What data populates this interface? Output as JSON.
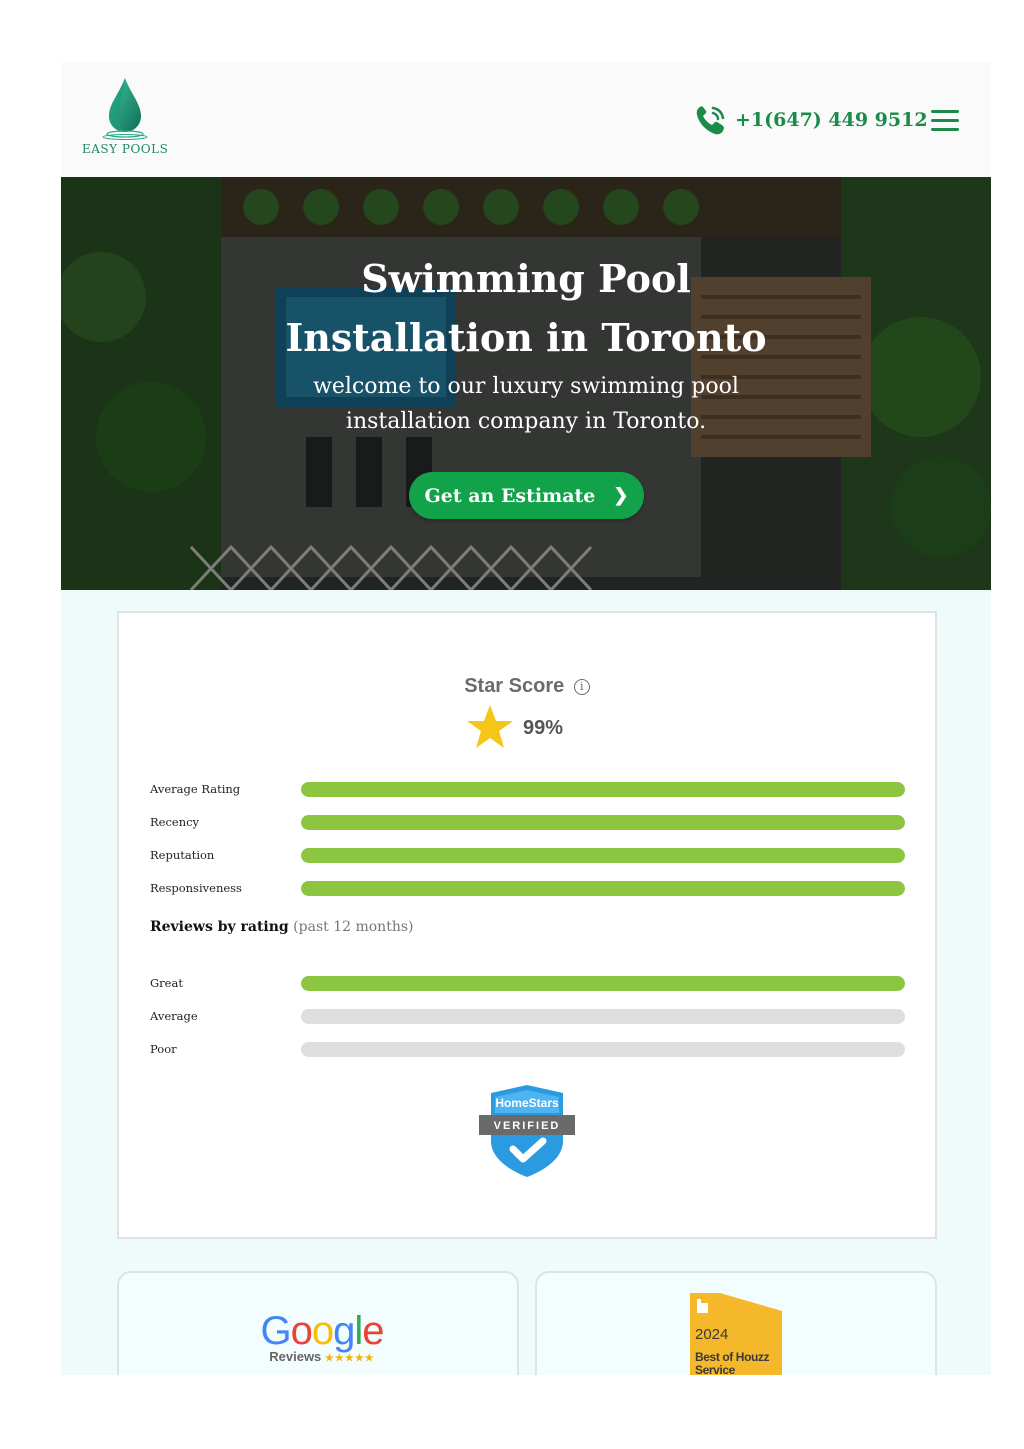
{
  "header": {
    "logo_text": "EASY POOLS",
    "phone": "+1(647) 449 9512",
    "menu_icon": "hamburger-icon",
    "phone_icon": "phone-icon"
  },
  "hero": {
    "title": "Swimming Pool Installation in Toronto",
    "subtitle": "welcome to our luxury swimming pool installation company in Toronto.",
    "cta_label": "Get an Estimate",
    "cta_icon": "chevron-right-icon"
  },
  "score": {
    "title": "Star Score",
    "info_glyph": "i",
    "percent": "99%",
    "metrics": [
      {
        "label": "Average Rating",
        "fill": 1.0
      },
      {
        "label": "Recency",
        "fill": 1.0
      },
      {
        "label": "Reputation",
        "fill": 1.0
      },
      {
        "label": "Responsiveness",
        "fill": 1.0
      }
    ],
    "reviews_heading": "Reviews by rating",
    "reviews_period": "(past 12 months)",
    "ratings": [
      {
        "label": "Great",
        "fill": 1.0
      },
      {
        "label": "Average",
        "fill": 0.0
      },
      {
        "label": "Poor",
        "fill": 0.0
      }
    ],
    "badge_brand": "HomeStars",
    "badge_text": "VERIFIED"
  },
  "cards": {
    "google_word": "Google",
    "google_sub": "Reviews",
    "google_stars": "★★★★★",
    "houzz_year": "2024",
    "houzz_text": "Best of Houzz Service"
  },
  "colors": {
    "brand_green": "#1b8b49",
    "cta_green": "#12a24a",
    "bar_green": "#8cc641",
    "bar_empty": "#dedede",
    "page_bg": "#effbfb"
  }
}
